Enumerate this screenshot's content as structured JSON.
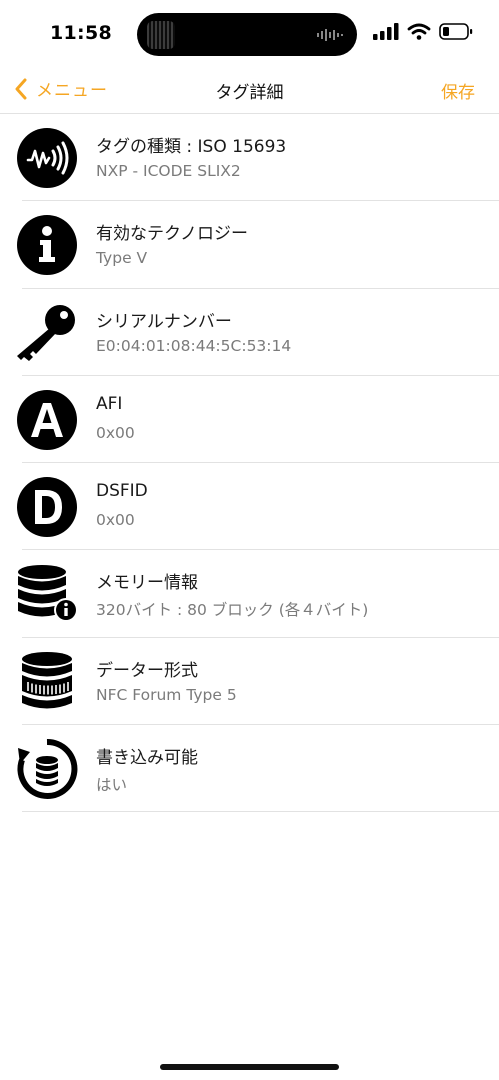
{
  "status_bar": {
    "time": "11:58",
    "icons": [
      "signal-icon",
      "wifi-icon",
      "battery-icon"
    ]
  },
  "nav": {
    "back_label": "メニュー",
    "title": "タグ詳細",
    "save_label": "保存",
    "accent_color": "#f5a623"
  },
  "rows": [
    {
      "icon": "nfc-tag-icon",
      "title": "タグの種類 : ISO 15693",
      "subtitle": "NXP - ICODE SLIX2"
    },
    {
      "icon": "info-icon",
      "title": "有効なテクノロジー",
      "subtitle": "Type V"
    },
    {
      "icon": "key-icon",
      "title": "シリアルナンバー",
      "subtitle": "E0:04:01:08:44:5C:53:14"
    },
    {
      "icon": "letter-a-icon",
      "title": "AFI",
      "subtitle": "0x00"
    },
    {
      "icon": "letter-d-icon",
      "title": "DSFID",
      "subtitle": "0x00"
    },
    {
      "icon": "database-info-icon",
      "title": "メモリー情報",
      "subtitle": "320バイト : 80 ブロック (各４バイト)"
    },
    {
      "icon": "database-format-icon",
      "title": "データー形式",
      "subtitle": "NFC Forum Type 5"
    },
    {
      "icon": "writable-icon",
      "title": "書き込み可能",
      "subtitle": "はい"
    }
  ]
}
